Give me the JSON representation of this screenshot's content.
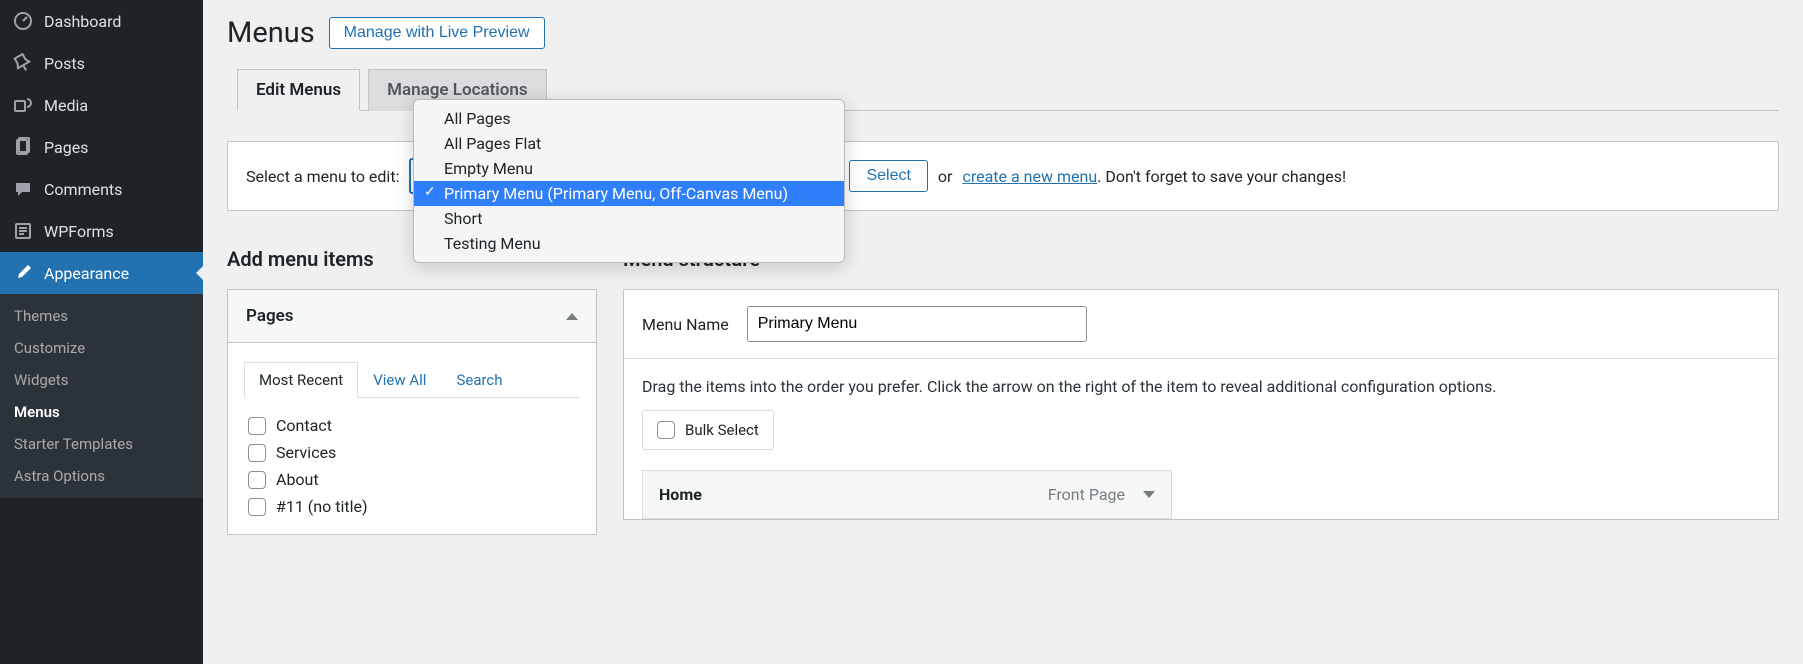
{
  "sidebar": {
    "items": [
      {
        "label": "Dashboard",
        "icon": "dash"
      },
      {
        "label": "Posts",
        "icon": "pin"
      },
      {
        "label": "Media",
        "icon": "media"
      },
      {
        "label": "Pages",
        "icon": "pages"
      },
      {
        "label": "Comments",
        "icon": "comment"
      },
      {
        "label": "WPForms",
        "icon": "form"
      },
      {
        "label": "Appearance",
        "icon": "brush",
        "active": true
      }
    ],
    "subitems": [
      {
        "label": "Themes"
      },
      {
        "label": "Customize"
      },
      {
        "label": "Widgets"
      },
      {
        "label": "Menus",
        "current": true
      },
      {
        "label": "Starter Templates"
      },
      {
        "label": "Astra Options"
      }
    ]
  },
  "heading": {
    "title": "Menus",
    "preview_btn": "Manage with Live Preview"
  },
  "tabs": {
    "edit": "Edit Menus",
    "locations": "Manage Locations"
  },
  "select_row": {
    "prefix": "Select a menu to edit:",
    "select_btn": "Select",
    "or": "or",
    "new_menu_link": "create a new menu",
    "suffix": ". Don't forget to save your changes!"
  },
  "dropdown": {
    "options": [
      "All Pages",
      "All Pages Flat",
      "Empty Menu",
      "Primary Menu (Primary Menu, Off-Canvas Menu)",
      "Short",
      "Testing Menu"
    ],
    "selected_index": 3
  },
  "left_col": {
    "heading": "Add menu items",
    "panel_title": "Pages",
    "inner_tabs": {
      "recent": "Most Recent",
      "all": "View All",
      "search": "Search"
    },
    "pages": [
      "Contact",
      "Services",
      "About",
      "#11 (no title)"
    ]
  },
  "right_col": {
    "heading": "Menu structure",
    "menu_name_label": "Menu Name",
    "menu_name_value": "Primary Menu",
    "instructions": "Drag the items into the order you prefer. Click the arrow on the right of the item to reveal additional configuration options.",
    "bulk_select": "Bulk Select",
    "item": {
      "title": "Home",
      "type": "Front Page"
    }
  }
}
